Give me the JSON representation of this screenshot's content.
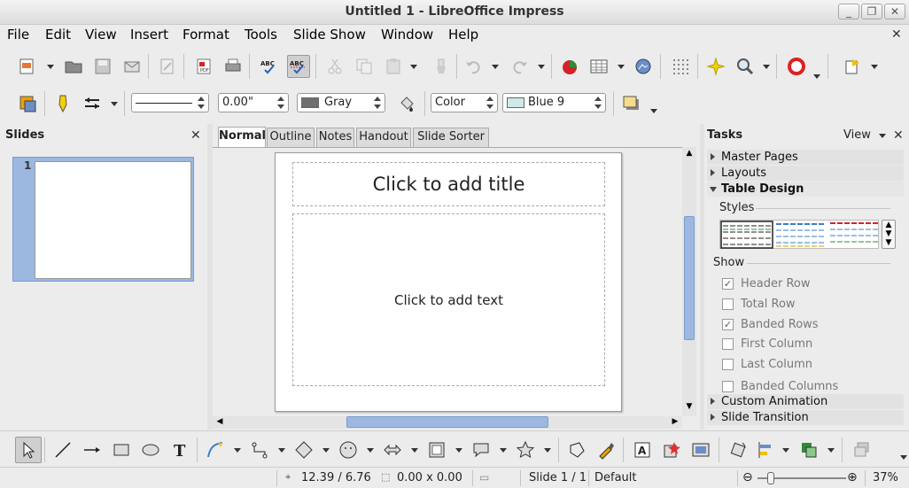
{
  "window": {
    "title": "Untitled 1 - LibreOffice Impress",
    "controls": [
      "_",
      "❐",
      "✕"
    ]
  },
  "menu": [
    "File",
    "Edit",
    "View",
    "Insert",
    "Format",
    "Tools",
    "Slide Show",
    "Window",
    "Help"
  ],
  "menu_close": "✕",
  "line_toolbar": {
    "line_width": "0.00\"",
    "line_color_label": "Gray",
    "line_color_hex": "#6e6e6e",
    "fill_type": "Color",
    "fill_color_label": "Blue 9",
    "fill_color_hex": "#cfe8e8"
  },
  "slides_panel": {
    "title": "Slides",
    "close": "✕",
    "slide_number": "1"
  },
  "tabs": [
    "Normal",
    "Outline",
    "Notes",
    "Handout",
    "Slide Sorter"
  ],
  "slide": {
    "title_placeholder": "Click to add title",
    "body_placeholder": "Click to add text"
  },
  "tasks_panel": {
    "title": "Tasks",
    "view_label": "View",
    "close": "✕",
    "sections": {
      "master_pages": "Master Pages",
      "layouts": "Layouts",
      "table_design": "Table Design",
      "custom_animation": "Custom Animation",
      "slide_transition": "Slide Transition"
    },
    "styles_label": "Styles",
    "show_label": "Show",
    "options": [
      {
        "label": "Header Row",
        "checked": true,
        "mark": "✓"
      },
      {
        "label": "Total Row",
        "checked": false,
        "mark": ""
      },
      {
        "label": "Banded Rows",
        "checked": true,
        "mark": "✓"
      },
      {
        "label": "First Column",
        "checked": false,
        "mark": ""
      },
      {
        "label": "Last Column",
        "checked": false,
        "mark": ""
      },
      {
        "label": "Banded Columns",
        "checked": false,
        "mark": ""
      }
    ]
  },
  "status": {
    "position": "12.39 / 6.76",
    "size": "0.00 x 0.00",
    "slide": "Slide 1 / 1",
    "master": "Default",
    "zoom_minus": "⊖",
    "zoom_plus": "⊕",
    "zoom": "37%"
  },
  "colors": {
    "accent": "#9db8e0",
    "selection_border": "#7a9ccd"
  }
}
